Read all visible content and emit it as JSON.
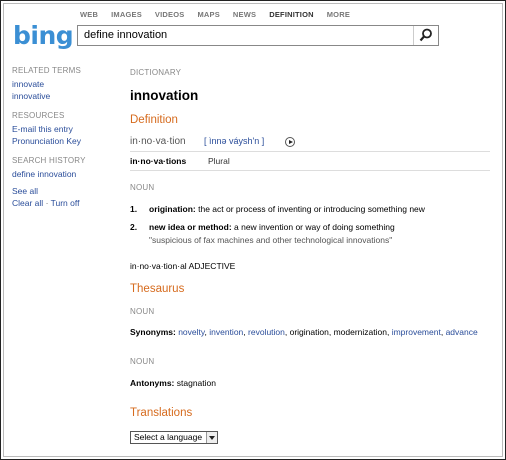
{
  "topnav": {
    "items": [
      {
        "label": "WEB"
      },
      {
        "label": "IMAGES"
      },
      {
        "label": "VIDEOS"
      },
      {
        "label": "MAPS"
      },
      {
        "label": "NEWS"
      },
      {
        "label": "DEFINITION",
        "active": true
      },
      {
        "label": "MORE"
      }
    ]
  },
  "logo": "bing",
  "search": {
    "value": "define innovation",
    "button_icon": "magnifier-icon"
  },
  "sidebar": {
    "related_heading": "RELATED TERMS",
    "related": [
      "innovate",
      "innovative"
    ],
    "resources_heading": "RESOURCES",
    "resources": [
      "E-mail this entry",
      "Pronunciation Key"
    ],
    "history_heading": "SEARCH HISTORY",
    "history": [
      "define innovation"
    ],
    "see_all": "See all",
    "clear_all": "Clear all",
    "sep": "·",
    "turn_off": "Turn off"
  },
  "main": {
    "dictionary_label": "DICTIONARY",
    "headword": "innovation",
    "definition_heading": "Definition",
    "syllables": "in·no·va·tion",
    "pronunciation": "[ ìnnə váysh'n ]",
    "plural_word": "in·no·va·tions",
    "plural_label": "Plural",
    "noun_label": "NOUN",
    "senses": [
      {
        "num": "1.",
        "term": "origination:",
        "text": " the act or process of inventing or introducing something new"
      },
      {
        "num": "2.",
        "term": "new idea or method:",
        "text": " a new invention or way of doing something"
      }
    ],
    "example": "\"suspicious of fax machines and other technological innovations\"",
    "derived": "in·no·va·tion·al ADJECTIVE",
    "thesaurus_heading": "Thesaurus",
    "thesaurus_noun_1": "NOUN",
    "synonyms_label": "Synonyms:",
    "synonyms": [
      {
        "w": "novelty",
        "link": true
      },
      {
        "w": "invention",
        "link": true
      },
      {
        "w": "revolution",
        "link": true
      },
      {
        "w": "origination",
        "link": false
      },
      {
        "w": "modernization",
        "link": false
      },
      {
        "w": "improvement",
        "link": true
      },
      {
        "w": "advance",
        "link": true
      }
    ],
    "thesaurus_noun_2": "NOUN",
    "antonyms_label": "Antonyms:",
    "antonyms": "stagnation",
    "translations_heading": "Translations",
    "language_select": "Select a language"
  }
}
